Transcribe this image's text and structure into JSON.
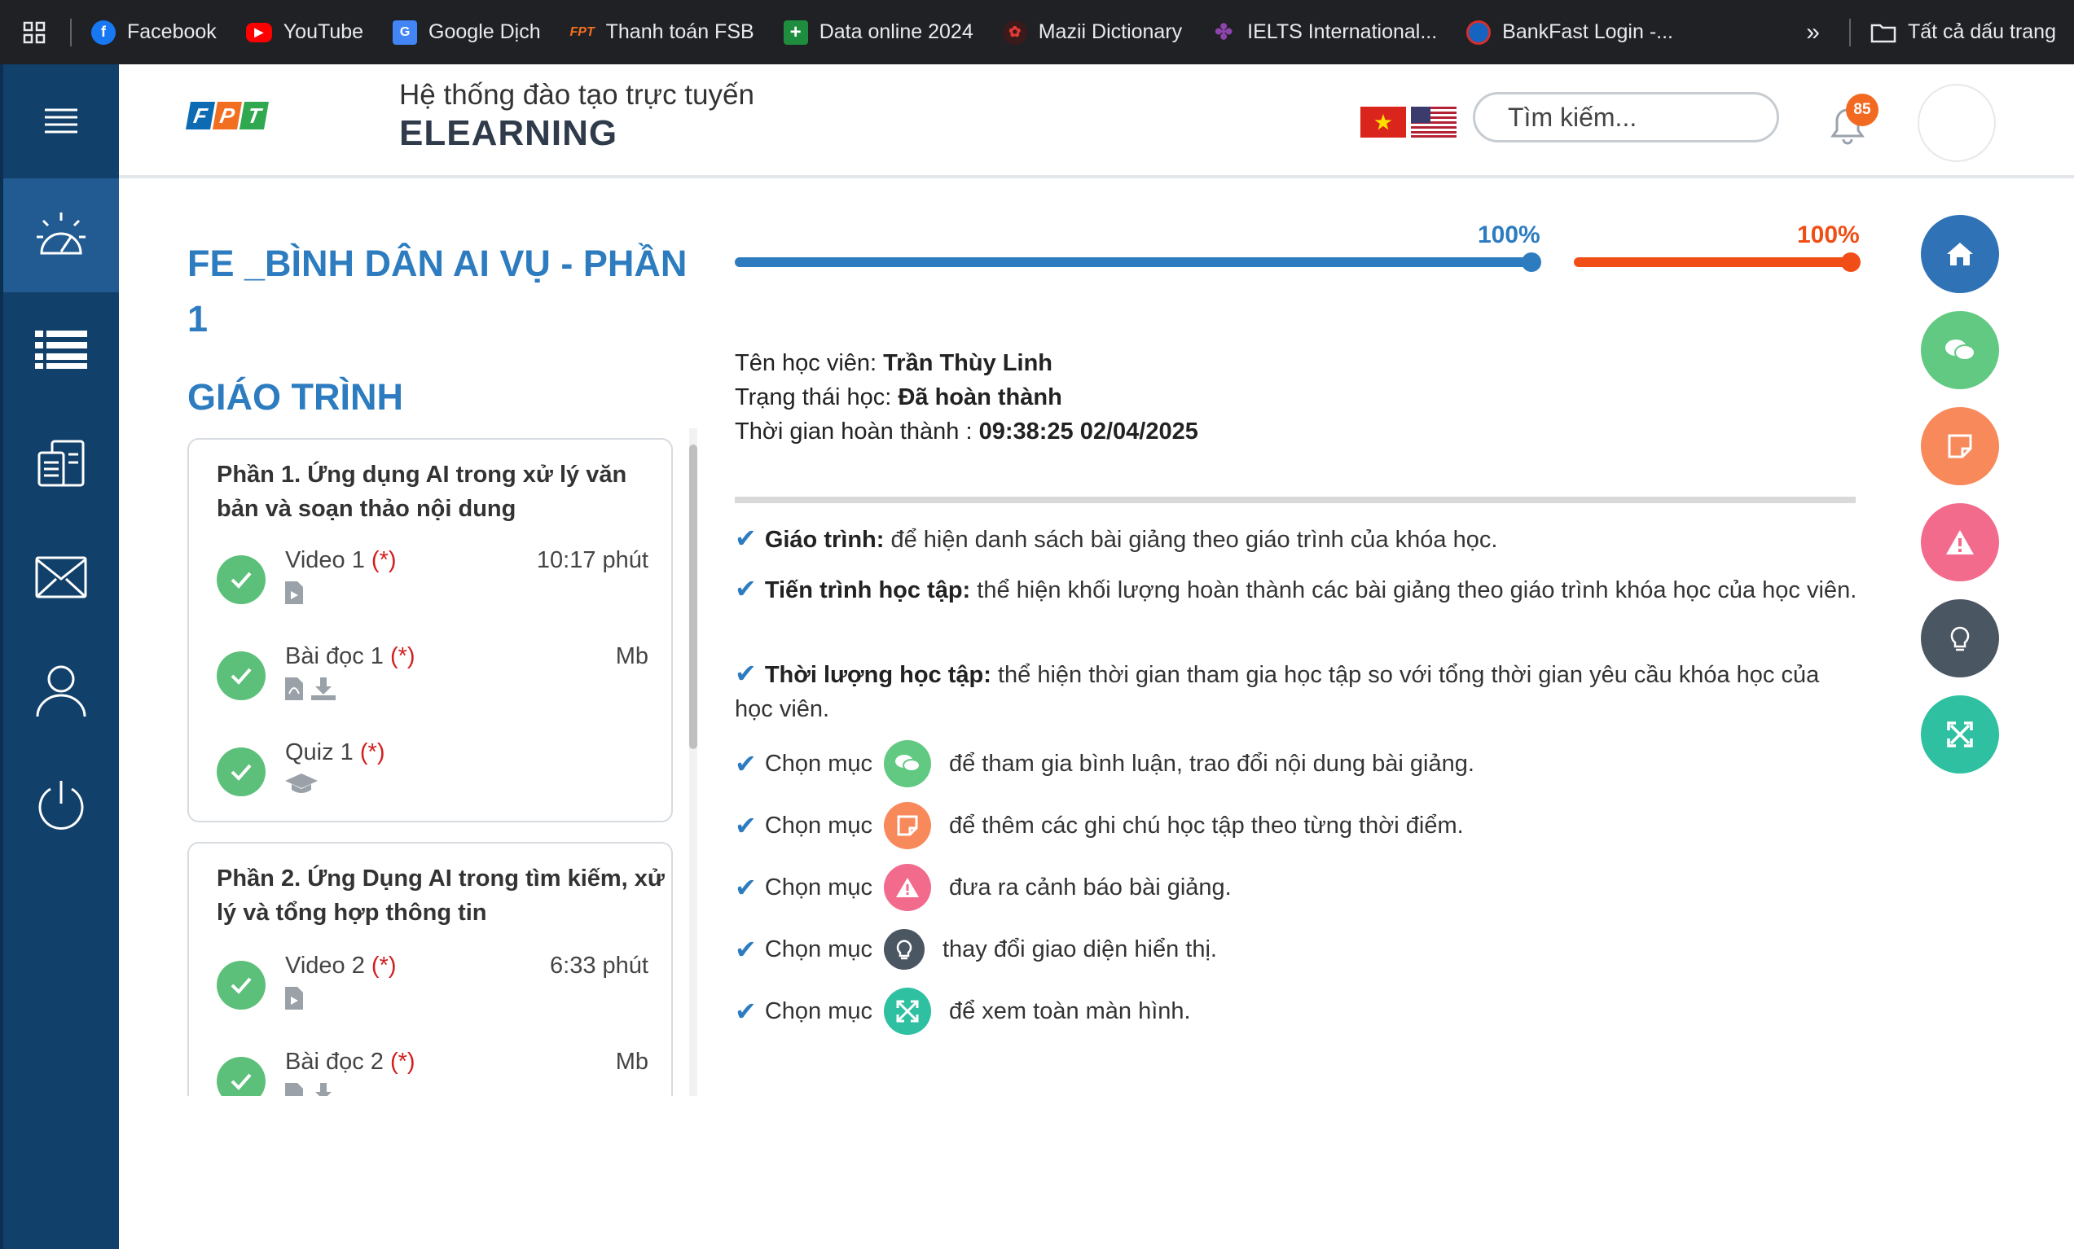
{
  "bookmarks": {
    "items": [
      {
        "label": "Facebook",
        "color": "#1877f2",
        "icon": "facebook-icon"
      },
      {
        "label": "YouTube",
        "color": "#ff0000",
        "icon": "youtube-icon"
      },
      {
        "label": "Google Dịch",
        "color": "#4285f4",
        "icon": "google-translate-icon"
      },
      {
        "label": "Thanh toán FSB",
        "color": "#f26f21",
        "icon": "fpt-icon"
      },
      {
        "label": "Data online 2024",
        "color": "#1e8e3e",
        "icon": "sheets-icon"
      },
      {
        "label": "Mazii Dictionary",
        "color": "#c62828",
        "icon": "mazii-icon"
      },
      {
        "label": "IELTS International...",
        "color": "#5c2d91",
        "icon": "ielts-icon"
      },
      {
        "label": "BankFast Login -...",
        "color": "#d32f2f",
        "icon": "bankfast-icon"
      }
    ],
    "more": "»",
    "all_label": "Tất cả dấu trang"
  },
  "header": {
    "logo_letters": [
      "F",
      "P",
      "T"
    ],
    "logo_colors": [
      "#0d6bb4",
      "#f26f21",
      "#2fa84f"
    ],
    "subtitle": "Hệ thống đào tạo trực tuyến",
    "title": "ELEARNING",
    "search_placeholder": "Tìm kiếm...",
    "notification_count": "85"
  },
  "course": {
    "title": "FE _BÌNH DÂN AI VỤ - PHẦN 1",
    "syllabus_heading": "GIÁO TRÌNH",
    "sections": [
      {
        "title": "Phần 1. Ứng dụng AI trong xử lý văn bản và soạn thảo nội dung",
        "lessons": [
          {
            "name": "Video 1",
            "req": "(*)",
            "duration": "10:17 phút",
            "type": "video"
          },
          {
            "name": "Bài đọc 1",
            "req": "(*)",
            "duration": "Mb",
            "type": "reading"
          },
          {
            "name": "Quiz 1",
            "req": "(*)",
            "duration": "",
            "type": "quiz"
          }
        ]
      },
      {
        "title": "Phần 2. Ứng Dụng AI trong tìm kiếm, xử lý và tổng hợp thông tin",
        "lessons": [
          {
            "name": "Video 2",
            "req": "(*)",
            "duration": "6:33 phút",
            "type": "video"
          },
          {
            "name": "Bài đọc 2",
            "req": "(*)",
            "duration": "Mb",
            "type": "reading"
          }
        ]
      }
    ]
  },
  "progress": {
    "learning_label": "100%",
    "learning_value": 100,
    "time_label": "100%",
    "time_value": 100
  },
  "student": {
    "name_label": "Tên học viên:",
    "name": "Trần Thùy Linh",
    "status_label": "Trạng thái học:",
    "status": "Đã hoàn thành",
    "completed_label": "Thời gian hoàn thành :",
    "completed_at": "09:38:25 02/04/2025"
  },
  "guide": {
    "syllabus_b": "Giáo trình:",
    "syllabus_t": "để hiện danh sách bài giảng theo giáo trình của khóa học.",
    "progress_b": "Tiến trình học tập:",
    "progress_t": "thể hiện khối lượng hoàn thành các bài giảng theo giáo trình khóa học của học viên.",
    "duration_b": "Thời lượng học tập:",
    "duration_t": "thể hiện thời gian tham gia học tập so với tổng thời gian yêu cầu khóa học của học viên.",
    "choose": "Chọn mục",
    "comment_t": "để tham gia bình luận, trao đổi nội dung bài giảng.",
    "note_t": "để thêm các ghi chú học tập theo từng thời điểm.",
    "warn_t": "đưa ra cảnh báo bài giảng.",
    "theme_t": "thay đổi giao diện hiển thị.",
    "full_t": "để xem toàn màn hình."
  },
  "colors": {
    "sidebar": "#11406a",
    "sidebar_active": "#215b92",
    "primary": "#2d7cc0",
    "orange": "#f04e16",
    "home": "#2f73b6",
    "comment": "#62c982",
    "note": "#f7895b",
    "warning": "#f26b8d",
    "theme": "#4b5663",
    "fullscreen": "#2ec0a1",
    "check": "#5cc07a"
  }
}
